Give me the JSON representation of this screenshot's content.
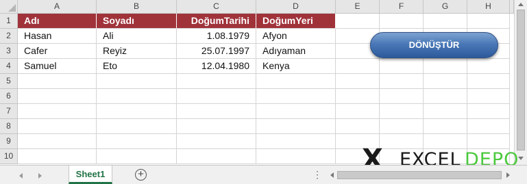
{
  "columns": [
    "A",
    "B",
    "C",
    "D",
    "E",
    "F",
    "G",
    "H"
  ],
  "rows": [
    "1",
    "2",
    "3",
    "4",
    "5",
    "6",
    "7",
    "8",
    "9",
    "10"
  ],
  "table": {
    "headers": [
      "Adı",
      "Soyadı",
      "DoğumTarihi",
      "DoğumYeri"
    ],
    "records": [
      [
        "Hasan",
        "Ali",
        "1.08.1979",
        "Afyon"
      ],
      [
        "Cafer",
        "Reyiz",
        "25.07.1997",
        "Adıyaman"
      ],
      [
        "Samuel",
        "Eto",
        "12.04.1980",
        "Kenya"
      ]
    ]
  },
  "button": {
    "label": "DÖNÜŞTÜR"
  },
  "sheet_tabs": [
    "Sheet1"
  ],
  "logo": {
    "mark": "X",
    "word1": "EXCEL",
    "word2": "DEPO"
  },
  "colors": {
    "header_fill": "#a0333a",
    "button_blue": "#4a78b7",
    "sheet_tab_green": "#217346",
    "logo_green": "#4cc93e"
  },
  "icons": [
    "sheet-prev-icon",
    "sheet-next-icon",
    "add-sheet-icon",
    "more-options-icon"
  ]
}
